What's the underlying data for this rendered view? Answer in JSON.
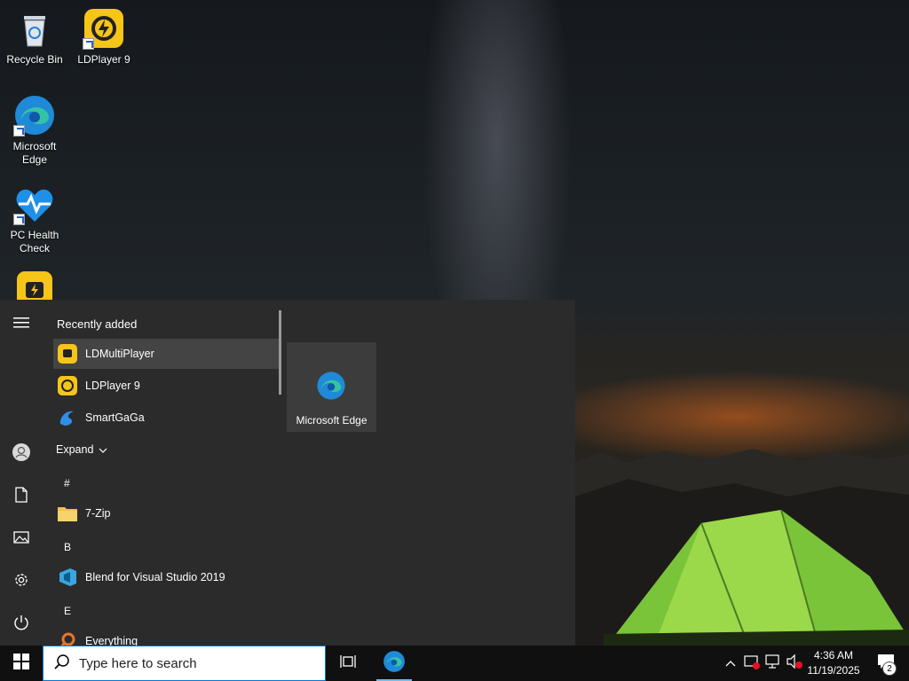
{
  "desktop": {
    "icons": [
      {
        "label": "Recycle Bin",
        "icon": "recycle-bin-icon"
      },
      {
        "label": "LDPlayer 9",
        "icon": "ldplayer-icon"
      },
      {
        "label": "Microsoft Edge",
        "icon": "edge-icon"
      },
      {
        "label": "PC Health Check",
        "icon": "health-check-icon"
      },
      {
        "label": "",
        "icon": "ldmultiplayer-icon"
      }
    ]
  },
  "start_menu": {
    "recently_added_title": "Recently added",
    "recent_apps": [
      {
        "label": "LDMultiPlayer",
        "icon": "ldmultiplayer-icon"
      },
      {
        "label": "LDPlayer 9",
        "icon": "ldplayer-icon"
      },
      {
        "label": "SmartGaGa",
        "icon": "smartgaga-icon"
      }
    ],
    "expand_label": "Expand",
    "sections": [
      {
        "letter": "#",
        "apps": [
          {
            "label": "7-Zip",
            "icon": "folder-icon"
          }
        ]
      },
      {
        "letter": "B",
        "apps": [
          {
            "label": "Blend for Visual Studio 2019",
            "icon": "blend-icon"
          }
        ]
      },
      {
        "letter": "E",
        "apps": [
          {
            "label": "Everything",
            "icon": "everything-icon"
          }
        ]
      }
    ],
    "tiles": [
      {
        "label": "Microsoft Edge",
        "icon": "edge-icon"
      }
    ]
  },
  "taskbar": {
    "search_placeholder": "Type here to search",
    "clock_time": "4:36 AM",
    "clock_date": "11/19/2025",
    "notification_count": "2"
  },
  "colors": {
    "accent": "#0078d7",
    "start_bg": "#2b2b2b",
    "taskbar_bg": "#101010",
    "ld_yellow": "#f5c518"
  }
}
